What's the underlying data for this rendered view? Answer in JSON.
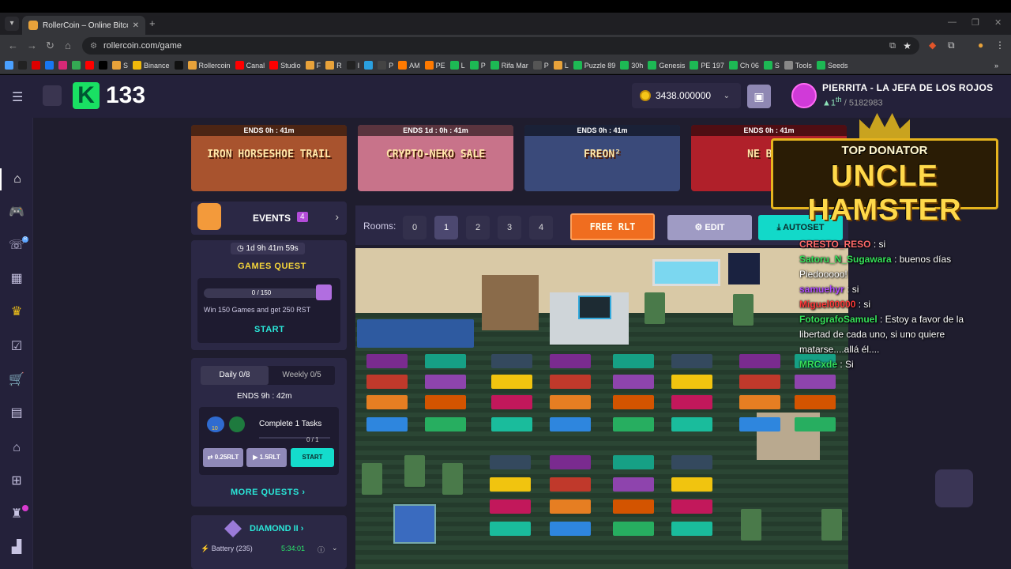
{
  "browser": {
    "tab_title": "RollerCoin – Online Bitcoin Mi",
    "url": "rollercoin.com/game",
    "bookmarks": [
      {
        "label": "",
        "color": "#4aa0ff"
      },
      {
        "label": "",
        "color": "#222"
      },
      {
        "label": "",
        "color": "#d00"
      },
      {
        "label": "",
        "color": "#1877f2"
      },
      {
        "label": "",
        "color": "#d62976"
      },
      {
        "label": "",
        "color": "#34a853"
      },
      {
        "label": "",
        "color": "#f00"
      },
      {
        "label": "",
        "color": "#000"
      },
      {
        "label": "S",
        "color": "#e8a23a"
      },
      {
        "label": "Binance",
        "color": "#f0b90b"
      },
      {
        "label": "",
        "color": "#111"
      },
      {
        "label": "Rollercoin",
        "color": "#e8a23a"
      },
      {
        "label": "Canal",
        "color": "#f00"
      },
      {
        "label": "Studio",
        "color": "#f00"
      },
      {
        "label": "F",
        "color": "#e8a23a"
      },
      {
        "label": "R",
        "color": "#e8a23a"
      },
      {
        "label": "I",
        "color": "#222"
      },
      {
        "label": "",
        "color": "#2aa0e0"
      },
      {
        "label": "P",
        "color": "#444"
      },
      {
        "label": "AM",
        "color": "#ff7a00"
      },
      {
        "label": "PE",
        "color": "#ff7a00"
      },
      {
        "label": "L",
        "color": "#1db954"
      },
      {
        "label": "P",
        "color": "#1db954"
      },
      {
        "label": "Rifa Mar",
        "color": "#1db954"
      },
      {
        "label": "P",
        "color": "#555"
      },
      {
        "label": "L",
        "color": "#e8a23a"
      },
      {
        "label": "Puzzle 89",
        "color": "#1db954"
      },
      {
        "label": "30h",
        "color": "#1db954"
      },
      {
        "label": "Genesis",
        "color": "#1db954"
      },
      {
        "label": "PE 197",
        "color": "#1db954"
      },
      {
        "label": "Ch 06",
        "color": "#1db954"
      },
      {
        "label": "S",
        "color": "#1db954"
      },
      {
        "label": "Tools",
        "color": "#888"
      },
      {
        "label": "Seeds",
        "color": "#1db954"
      }
    ]
  },
  "header": {
    "level": "133",
    "balance": "3438.000000",
    "profile_name": "PIERRITA - LA JEFA DE LOS ROJOS",
    "rank_pos": "1",
    "rank_sup": "th",
    "rank_total": "/ 5182983"
  },
  "banners": [
    {
      "ends": "ENDS  0h : 41m",
      "title": "IRON HORSESHOE TRAIL",
      "bg": "#a8532e"
    },
    {
      "ends": "ENDS  1d : 0h : 41m",
      "title": "CRYPTO-NEKO SALE",
      "bg": "#c8738a"
    },
    {
      "ends": "ENDS  0h : 41m",
      "title": "FREON²",
      "bg": "#3a4a7a"
    },
    {
      "ends": "ENDS  0h : 41m",
      "title": "NE BUND",
      "bg": "#b0202a"
    }
  ],
  "events": {
    "label": "EVENTS",
    "count": "4",
    "games_timer": "1d 9h 41m 59s",
    "games_title": "GAMES QUEST",
    "progress_text": "0 / 150",
    "progress": 0,
    "desc": "Win 150 Games and get 250 RST",
    "start": "START"
  },
  "quests": {
    "tab_daily": "Daily  0/8",
    "tab_weekly": "Weekly  0/5",
    "ends": "ENDS  9h : 42m",
    "task": "Complete 1 Tasks",
    "xp": "10",
    "task_progress": "0 / 1",
    "reward1": "0.25RLT",
    "reward2": "1.5RLT",
    "start": "START",
    "more": "MORE QUESTS"
  },
  "league": {
    "title": "DIAMOND II",
    "battery": "Battery (235)",
    "battery_time": "5:34:01"
  },
  "rooms": {
    "label": "Rooms:",
    "list": [
      "0",
      "1",
      "2",
      "3",
      "4"
    ],
    "active": "1",
    "free_rlt": "FREE RLT",
    "edit": "EDIT",
    "autoset": "AUTOSET"
  },
  "donor": {
    "sub": "TOP DONATOR",
    "main": "UNCLE HAMSTER"
  },
  "chat": [
    {
      "user": "CRESTO_RESO",
      "color": "#ff6a6a",
      "text": ": si"
    },
    {
      "user": "Satoru_N_Sugawara",
      "color": "#36e05a",
      "text": ": buenos días Piedooooo!"
    },
    {
      "user": "samuehyr",
      "color": "#b04cff",
      "text": ": si"
    },
    {
      "user": "Miguel00000",
      "color": "#ff3a3a",
      "text": ": si"
    },
    {
      "user": "FotografoSamuel",
      "color": "#36e05a",
      "text": ": Estoy a favor de la libertad de cada uno, si uno quiere matarse....allá él...."
    },
    {
      "user": "MRCxde",
      "color": "#36e05a",
      "text": ": Si"
    }
  ]
}
